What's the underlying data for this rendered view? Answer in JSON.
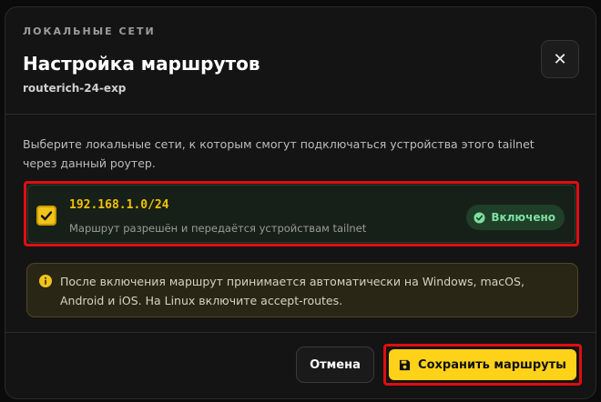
{
  "header": {
    "eyebrow": "ЛОКАЛЬНЫЕ СЕТИ",
    "title": "Настройка маршрутов",
    "subtitle": "routerich-24-exp",
    "close_label": "✕"
  },
  "body": {
    "description": "Выберите локальные сети, к которым смогут подключаться устройства этого tailnet через данный роутер.",
    "route": {
      "ip": "192.168.1.0/24",
      "note": "Маршрут разрешён и передаётся устройствам tailnet",
      "checked": true,
      "status": "Включено"
    },
    "info": "После включения маршрут принимается автоматически на Windows, macOS, Android и iOS. На Linux включите accept-routes."
  },
  "footer": {
    "cancel_label": "Отмена",
    "save_label": "Сохранить маршруты"
  },
  "colors": {
    "accent": "#ffd21a",
    "status_green": "#7ee0a0",
    "highlight": "#e00d12"
  },
  "icons": {
    "close": "close-icon",
    "check": "check-icon",
    "status": "check-circle-icon",
    "info": "info-icon",
    "save": "floppy-disk-icon"
  }
}
